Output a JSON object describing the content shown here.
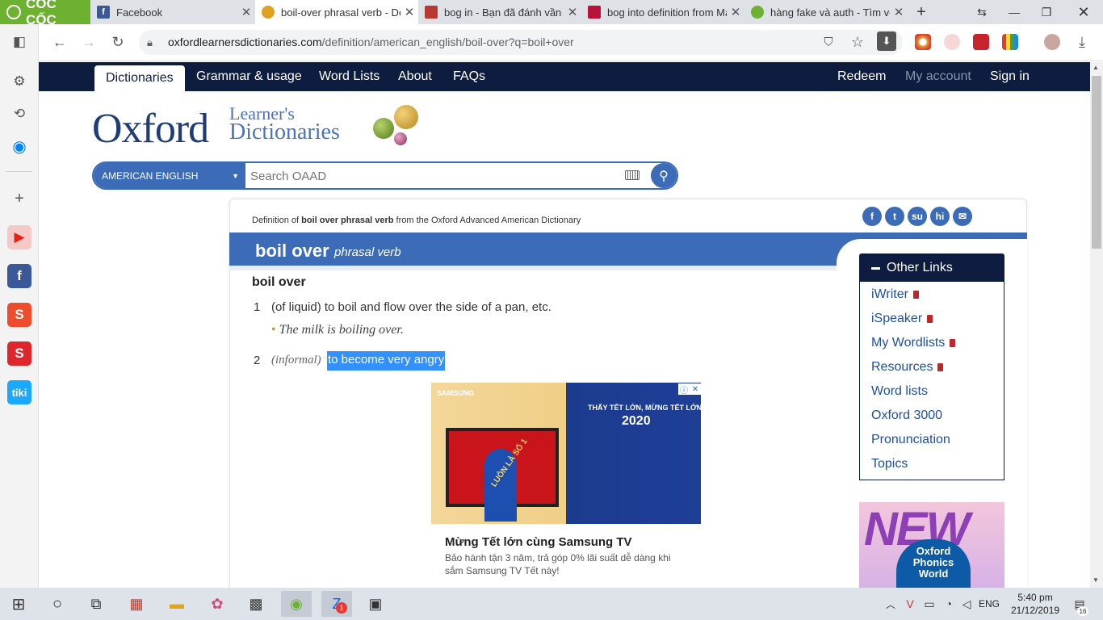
{
  "browser": {
    "brand": "CỐC CỐC",
    "tabs": [
      {
        "title": "Facebook",
        "color": "#3b5998",
        "glyph": "f"
      },
      {
        "title": "boil-over phrasal verb - Def",
        "color": "#e0a020",
        "glyph": "●"
      },
      {
        "title": "bog in - Bạn đã đánh vần đ",
        "color": "#b8392f",
        "glyph": "▣"
      },
      {
        "title": "bog into definition from Ma",
        "color": "#b8123a",
        "glyph": "▮"
      },
      {
        "title": "hàng fake và auth - Tìm với",
        "color": "#6cb130",
        "glyph": "◎"
      }
    ],
    "new_tab": "+",
    "url_domain": "oxfordlearnersdictionaries.com",
    "url_path": "/definition/american_english/boil-over?q=boil+over"
  },
  "site": {
    "nav_left": [
      "Dictionaries",
      "Grammar & usage",
      "Word Lists",
      "About",
      "FAQs"
    ],
    "nav_right": [
      "Redeem",
      "My account",
      "Sign in"
    ],
    "logo_main": "Oxford",
    "logo_sub1": "Learner's",
    "logo_sub2": "Dictionaries",
    "dict_select": "AMERICAN ENGLISH",
    "search_placeholder": "Search OAAD"
  },
  "entry": {
    "def_of_pre": "Definition of ",
    "def_of_word": "boil over phrasal verb",
    "def_of_post": " from the Oxford Advanced American Dictionary",
    "headword": "boil over",
    "pos": "phrasal verb",
    "phrase": "boil over",
    "senses": [
      {
        "num": "1",
        "text": "(of liquid) to boil and flow over the side of a pan, etc.",
        "example": "The milk is boiling over."
      },
      {
        "num": "2",
        "label": "(informal)",
        "text": "to become very angry"
      }
    ]
  },
  "ad": {
    "brand": "SAMSUNG",
    "headline": "THẤY TẾT LỚN, MỪNG TẾT LỚN",
    "year": "2020",
    "banner": "LUÔN LÀ SỐ 1",
    "title": "Mừng Tết lớn cùng Samsung TV",
    "body": "Bảo hành tận 3 năm, trả góp 0% lãi suất dễ dàng khi sắm Samsung TV Tết này!"
  },
  "other_links": {
    "title": "Other Links",
    "items": [
      {
        "label": "iWriter",
        "locked": true
      },
      {
        "label": "iSpeaker",
        "locked": true
      },
      {
        "label": "My Wordlists",
        "locked": true
      },
      {
        "label": "Resources",
        "locked": true
      },
      {
        "label": "Word lists",
        "locked": false
      },
      {
        "label": "Oxford 3000",
        "locked": false
      },
      {
        "label": "Pronunciation",
        "locked": false
      },
      {
        "label": "Topics",
        "locked": false
      }
    ]
  },
  "promo": {
    "new": "NEW",
    "line1": "Oxford",
    "line2": "Phonics",
    "line3": "World"
  },
  "taskbar": {
    "lang": "ENG",
    "time": "5:40 pm",
    "date": "21/12/2019",
    "notif": "16",
    "zalo_badge": "1"
  }
}
